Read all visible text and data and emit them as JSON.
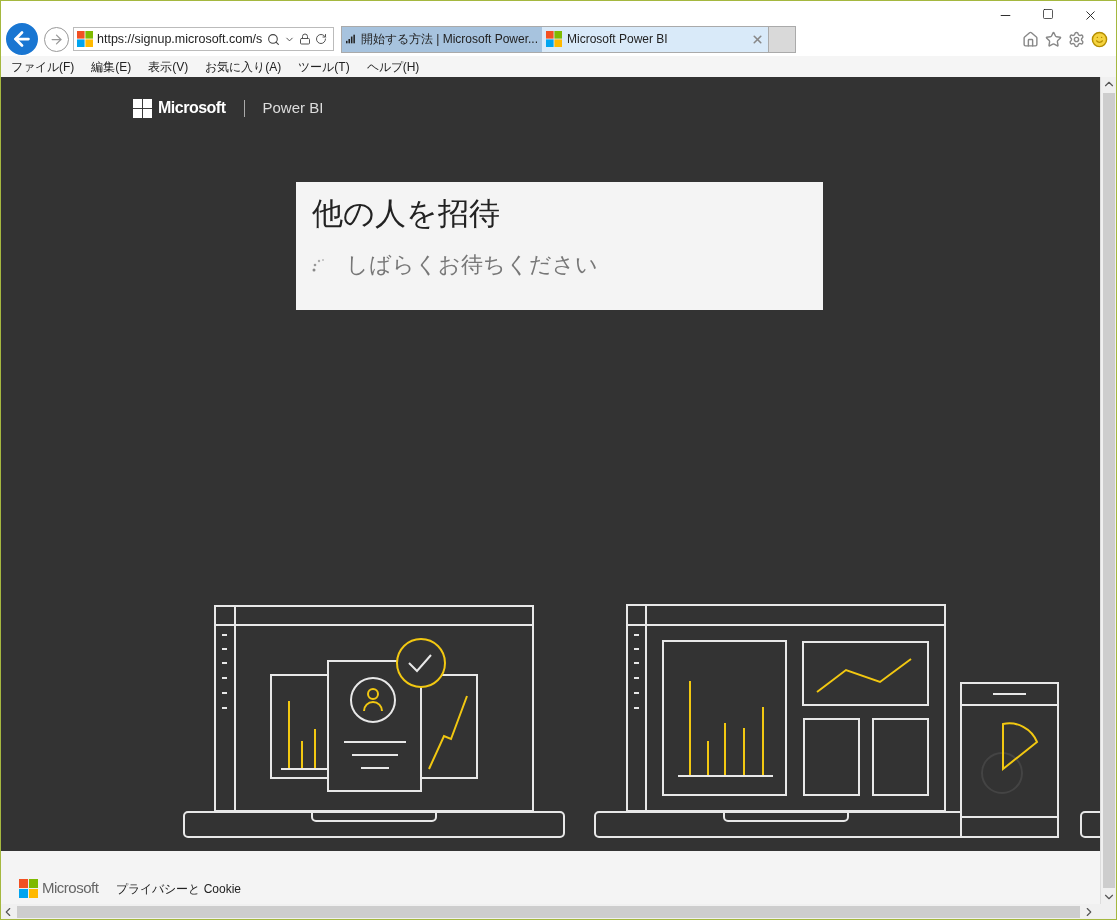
{
  "browser": {
    "address": "https://signup.microsoft.com/s",
    "tabs": [
      {
        "kind": "bars",
        "label": "開始する方法 | Microsoft Power...",
        "selected": false
      },
      {
        "kind": "windows",
        "label": "Microsoft Power BI",
        "selected": true
      }
    ],
    "menu": [
      "ファイル(F)",
      "編集(E)",
      "表示(V)",
      "お気に入り(A)",
      "ツール(T)",
      "ヘルプ(H)"
    ]
  },
  "page": {
    "brand": "Microsoft",
    "product": "Power BI",
    "dialog": {
      "title": "他の人を招待",
      "status": "しばらくお待ちください"
    }
  },
  "footer": {
    "brand": "Microsoft",
    "link": "プライバシーと Cookie"
  }
}
